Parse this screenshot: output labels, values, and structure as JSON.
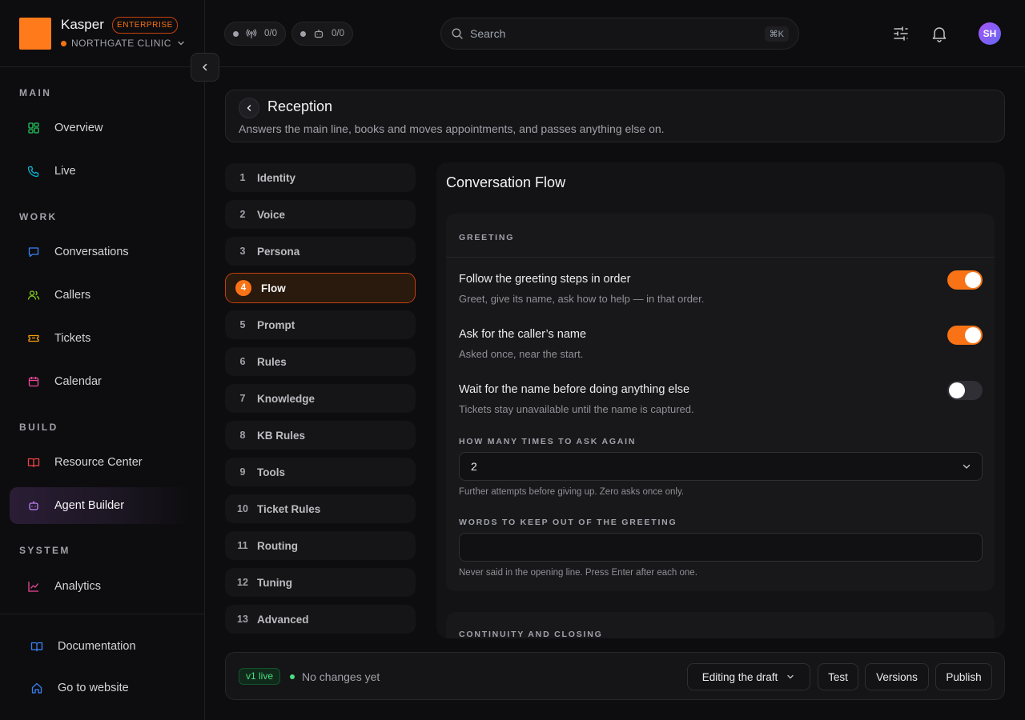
{
  "brand": {
    "name": "Kasper",
    "badge": "ENTERPRISE",
    "org": "NORTHGATE CLINIC",
    "accent": "#f97316"
  },
  "topbar": {
    "pill_calls": "0/0",
    "pill_agents": "0/0",
    "search_placeholder": "Search",
    "search_shortcut": "⌘K",
    "avatar_initials": "SH"
  },
  "sidebar": {
    "sections": {
      "main": "MAIN",
      "work": "WORK",
      "build": "BUILD",
      "system": "SYSTEM"
    },
    "items": {
      "overview": "Overview",
      "live": "Live",
      "conversations": "Conversations",
      "callers": "Callers",
      "tickets": "Tickets",
      "calendar": "Calendar",
      "resource_center": "Resource Center",
      "agent_builder": "Agent Builder",
      "analytics": "Analytics"
    },
    "footer": {
      "documentation": "Documentation",
      "website": "Go to website"
    }
  },
  "header": {
    "title": "Reception",
    "subtitle": "Answers the main line, books and moves appointments, and passes anything else on."
  },
  "steps": [
    {
      "num": "1",
      "label": "Identity"
    },
    {
      "num": "2",
      "label": "Voice"
    },
    {
      "num": "3",
      "label": "Persona"
    },
    {
      "num": "4",
      "label": "Flow"
    },
    {
      "num": "5",
      "label": "Prompt"
    },
    {
      "num": "6",
      "label": "Rules"
    },
    {
      "num": "7",
      "label": "Knowledge"
    },
    {
      "num": "8",
      "label": "KB Rules"
    },
    {
      "num": "9",
      "label": "Tools"
    },
    {
      "num": "10",
      "label": "Ticket Rules"
    },
    {
      "num": "11",
      "label": "Routing"
    },
    {
      "num": "12",
      "label": "Tuning"
    },
    {
      "num": "13",
      "label": "Advanced"
    }
  ],
  "content": {
    "title": "Conversation Flow",
    "greeting": {
      "section_label": "GREETING",
      "settings": [
        {
          "title": "Follow the greeting steps in order",
          "description": "Greet, give its name, ask how to help — in that order.",
          "enabled": true
        },
        {
          "title": "Ask for the caller’s name",
          "description": "Asked once, near the start.",
          "enabled": true
        },
        {
          "title": "Wait for the name before doing anything else",
          "description": "Tickets stay unavailable until the name is captured.",
          "enabled": false
        }
      ],
      "retries_label": "HOW MANY TIMES TO ASK AGAIN",
      "retries_value": "2",
      "retries_hint": "Further attempts before giving up. Zero asks once only.",
      "exclude_label": "WORDS TO KEEP OUT OF THE GREETING",
      "exclude_value": "",
      "exclude_hint": "Never said in the opening line. Press Enter after each one."
    },
    "continuity_label": "CONTINUITY AND CLOSING"
  },
  "bottom_bar": {
    "version": "v1 live",
    "status": "No changes yet",
    "mode": "Editing the draft",
    "test": "Test",
    "versions": "Versions",
    "publish": "Publish"
  }
}
